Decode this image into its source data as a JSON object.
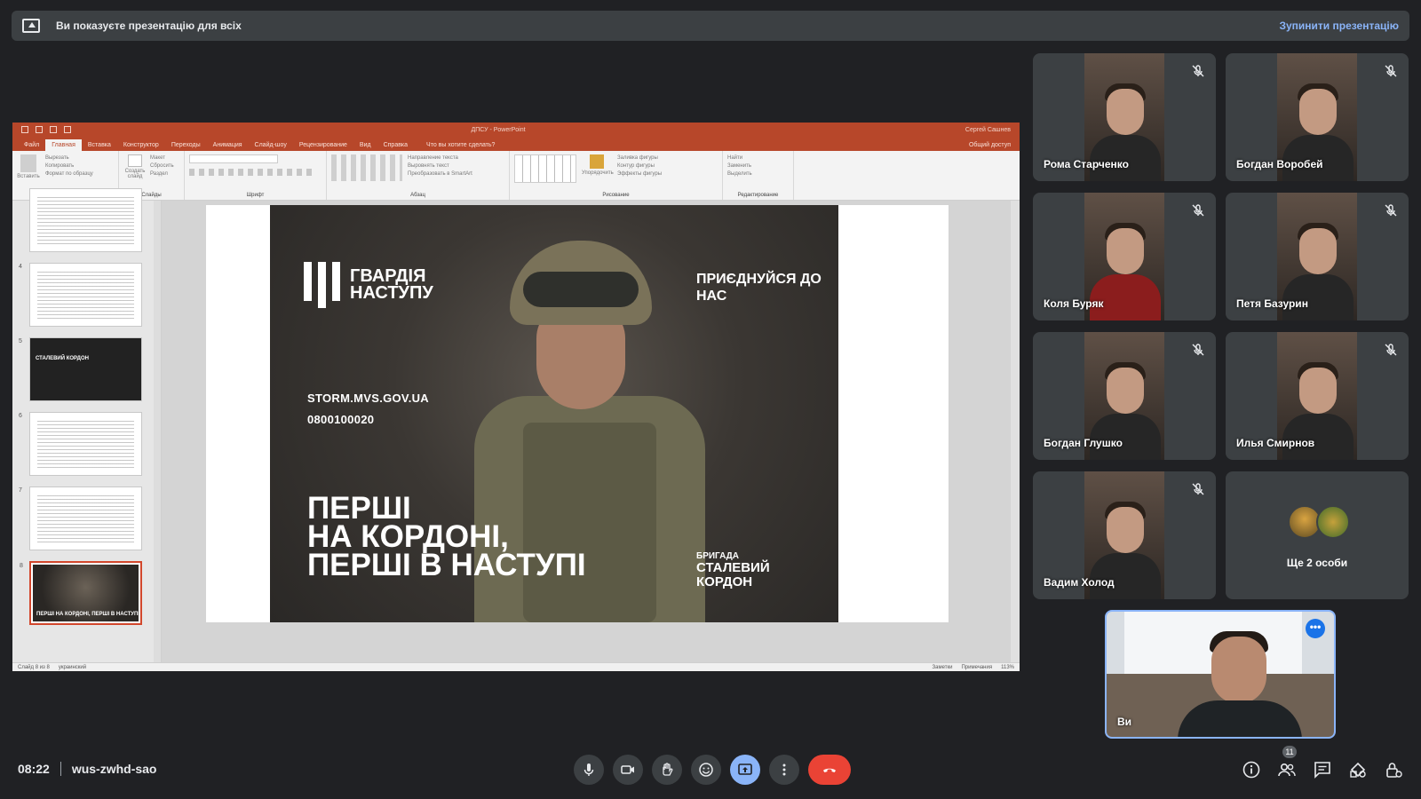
{
  "banner": {
    "message": "Ви показуєте презентацію для всіх",
    "stop_label": "Зупинити презентацію"
  },
  "ppt": {
    "doc_title": "ДПСУ - PowerPoint",
    "user": "Сергей Сашнев",
    "tabs": [
      "Файл",
      "Главная",
      "Вставка",
      "Конструктор",
      "Переходы",
      "Анимация",
      "Слайд-шоу",
      "Рецензирование",
      "Вид",
      "Справка"
    ],
    "tell_me": "Что вы хотите сделать?",
    "share": "Общий доступ",
    "ribbon_groups": [
      {
        "label": "Буфер обмена",
        "items": [
          "Вырезать",
          "Копировать",
          "Формат по образцу"
        ]
      },
      {
        "label": "Слайды",
        "items": [
          "Макет",
          "Сбросить",
          "Раздел"
        ]
      },
      {
        "label": "Шрифт",
        "items": [
          "",
          "",
          ""
        ]
      },
      {
        "label": "Абзац",
        "items": [
          "Направление текста",
          "Выровнять текст",
          "Преобразовать в SmartArt"
        ]
      },
      {
        "label": "Рисование",
        "items": [
          "Упорядочить",
          "Заливка фигуры",
          "Контур фигуры",
          "Эффекты фигуры"
        ]
      },
      {
        "label": "Редактирование",
        "items": [
          "Найти",
          "Заменить",
          "Выделить"
        ]
      }
    ],
    "paste_label": "Вставить",
    "create_slide_label": "Создать слайд",
    "thumb_numbers": [
      "4",
      "5",
      "6",
      "7",
      "8"
    ],
    "thumb5_text": "СТАЛЕВИЙ КОРДОН",
    "thumb8_text": "ПЕРШІ НА КОРДОНІ, ПЕРШІ В НАСТУПІ",
    "status_left": "Слайд 8 из 8",
    "status_lang": "украинский",
    "status_notes": "Заметки",
    "status_comments": "Примечания",
    "zoom": "113%",
    "slide": {
      "logo_text": "ГВАРДІЯ НАСТУПУ",
      "join_text": "ПРИЄДНУЙСЯ ДО НАС",
      "site": "STORM.MVS.GOV.UA",
      "phone": "0800100020",
      "headline_1": "ПЕРШІ",
      "headline_2": "НА КОРДОНІ,",
      "headline_3": "ПЕРШІ В НАСТУПІ",
      "brigade_small": "БРИГАДА",
      "brigade_large": "СТАЛЕВИЙ КОРДОН"
    }
  },
  "participants": [
    {
      "name": "Рома Старченко",
      "muted": true
    },
    {
      "name": "Богдан Воробей",
      "muted": true
    },
    {
      "name": "Коля Буряк",
      "muted": true
    },
    {
      "name": "Петя Базурин",
      "muted": true
    },
    {
      "name": "Богдан Глушко",
      "muted": true
    },
    {
      "name": "Илья Смирнов",
      "muted": true
    },
    {
      "name": "Вадим Холод",
      "muted": true
    }
  ],
  "more_participants": "Ще 2 особи",
  "self_name": "Ви",
  "meeting": {
    "time": "08:22",
    "code": "wus-zwhd-sao",
    "participant_count": "11"
  },
  "icons": {
    "mic": "mic-icon",
    "camera": "camera-icon",
    "hand": "raise-hand-icon",
    "emoji": "emoji-icon",
    "present": "present-screen-icon",
    "more": "more-options-icon",
    "end": "end-call-icon",
    "info": "info-icon",
    "people": "people-icon",
    "chat": "chat-icon",
    "activities": "activities-icon",
    "lock": "host-controls-icon"
  },
  "colors": {
    "background": "#202124",
    "tile": "#3c4043",
    "accent": "#8ab4f8",
    "end_call": "#ea4335",
    "ppt_brand": "#b7472a"
  }
}
